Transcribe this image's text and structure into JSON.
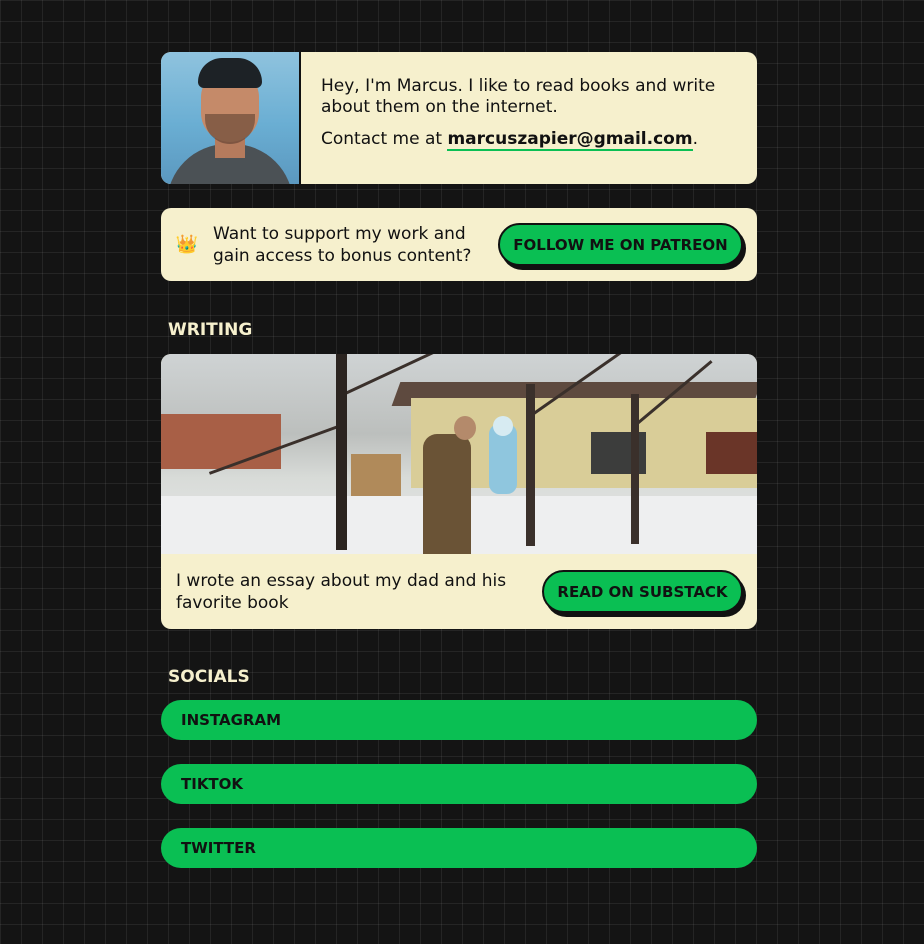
{
  "intro": {
    "greeting": "Hey, I'm Marcus. I like to read books and write about them on the internet.",
    "contact_prefix": "Contact me at ",
    "email": "marcuszapier@gmail.com",
    "contact_suffix": "."
  },
  "patreon": {
    "icon": "👑",
    "text": "Want to support my work and gain access to bonus content?",
    "button_label": "FOLLOW ME ON PATREON"
  },
  "writing": {
    "title": "WRITING",
    "description": "I wrote an essay about my dad and his favorite book",
    "button_label": "READ ON SUBSTACK"
  },
  "socials": {
    "title": "SOCIALS",
    "links": [
      {
        "label": "INSTAGRAM"
      },
      {
        "label": "TIKTOK"
      },
      {
        "label": "TWITTER"
      }
    ]
  },
  "colors": {
    "background": "#141414",
    "card": "#f6f0cd",
    "accent_green": "#0abf53",
    "text_dark": "#111111",
    "heading_light": "#f6f0cd"
  }
}
